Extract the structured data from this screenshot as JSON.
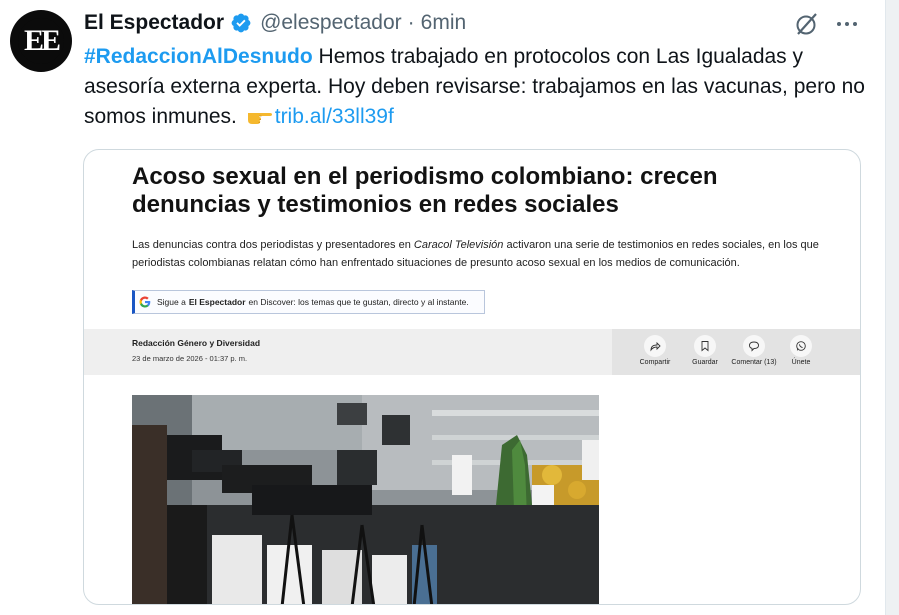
{
  "tweet": {
    "display_name": "El Espectador",
    "handle": "@elespectador",
    "separator": "·",
    "time": "6min",
    "avatar_text": "EE",
    "hashtag": "#RedaccionAlDesnudo",
    "body_text": " Hemos trabajado en protocolos con Las Igualadas y asesoría externa experta. Hoy deben revisarse: trabajamos en las vacunas, pero no somos inmunes. ",
    "link": "trib.al/33ll39f"
  },
  "card": {
    "title": "Acoso sexual en el periodismo colombiano: crecen denuncias y testimonios en redes sociales",
    "lead_part1": "Las denuncias contra dos periodistas y presentadores en ",
    "lead_italic": "Caracol Televisión",
    "lead_part2": " activaron una serie de testimonios en redes sociales, en los que periodistas colombianas relatan cómo han enfrentado situaciones de presunto acoso sexual en los medios de comunicación.",
    "discover_prefix": "Sigue a",
    "discover_brand": "El Espectador",
    "discover_suffix": "en Discover: los temas que te gustan, directo y al instante.",
    "author": "Redacción Género y Diversidad",
    "date": "23 de marzo de 2026 - 01:37 p. m.",
    "actions": [
      {
        "label": "Compartir",
        "icon": "share-icon"
      },
      {
        "label": "Guardar",
        "icon": "bookmark-icon"
      },
      {
        "label": "Comentar (13)",
        "icon": "comment-icon"
      },
      {
        "label": "Únete",
        "icon": "whatsapp-icon"
      }
    ]
  },
  "colors": {
    "accent": "#1d9bf0",
    "verified": "#1d9bf0",
    "text": "#0f1419",
    "muted": "#536471"
  }
}
